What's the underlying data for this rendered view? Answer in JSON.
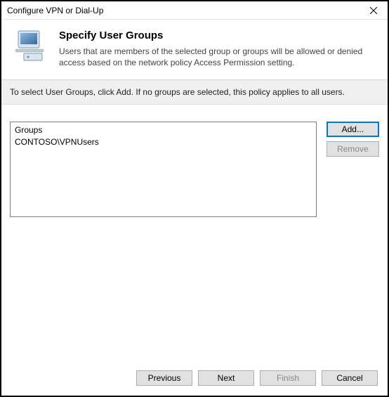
{
  "window": {
    "title": "Configure VPN or Dial-Up"
  },
  "header": {
    "title": "Specify User Groups",
    "description": "Users that are members of the selected group or groups will be allowed or denied access based on the network policy Access Permission setting."
  },
  "instruction": "To select User Groups, click Add. If no groups are selected, this policy applies to all users.",
  "groups": {
    "header": "Groups",
    "items": [
      "CONTOSO\\VPNUsers"
    ]
  },
  "buttons": {
    "add": "Add...",
    "remove": "Remove",
    "previous": "Previous",
    "next": "Next",
    "finish": "Finish",
    "cancel": "Cancel"
  }
}
